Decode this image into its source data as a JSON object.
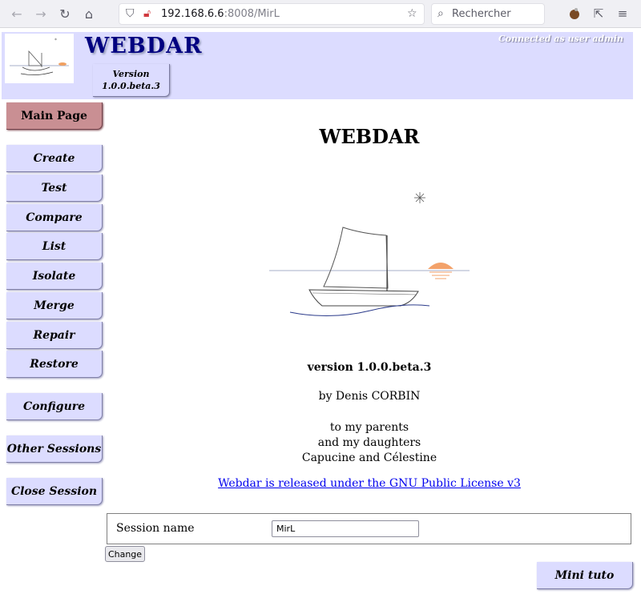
{
  "browser": {
    "url_host": "192.168.6.6",
    "url_rest": ":8008/MirL",
    "search_placeholder": "Rechercher"
  },
  "header": {
    "app_title": "WEBDAR",
    "version_label": "Version",
    "version_number": "1.0.0.beta.3",
    "connected_text": "Connected as user admin"
  },
  "menu": {
    "main_page": "Main Page",
    "create": "Create",
    "test": "Test",
    "compare": "Compare",
    "list": "List",
    "isolate": "Isolate",
    "merge": "Merge",
    "repair": "Repair",
    "restore": "Restore",
    "configure": "Configure",
    "other_sessions": "Other Sessions",
    "close_session": "Close Session"
  },
  "main": {
    "title": "WEBDAR",
    "version": "version 1.0.0.beta.3",
    "author": "by Denis CORBIN",
    "dedication_1": "to my parents",
    "dedication_2": "and my daughters",
    "dedication_3": "Capucine and Célestine",
    "license_link": "Webdar is released under the GNU Public License v3"
  },
  "session": {
    "label": "Session name",
    "value": "MirL",
    "change_button": "Change"
  },
  "mini_tuto": "Mini tuto",
  "colors": {
    "banner": "#dcdcff",
    "title": "#000080",
    "main_page_button": "#c98f93",
    "link": "#0000ee"
  }
}
